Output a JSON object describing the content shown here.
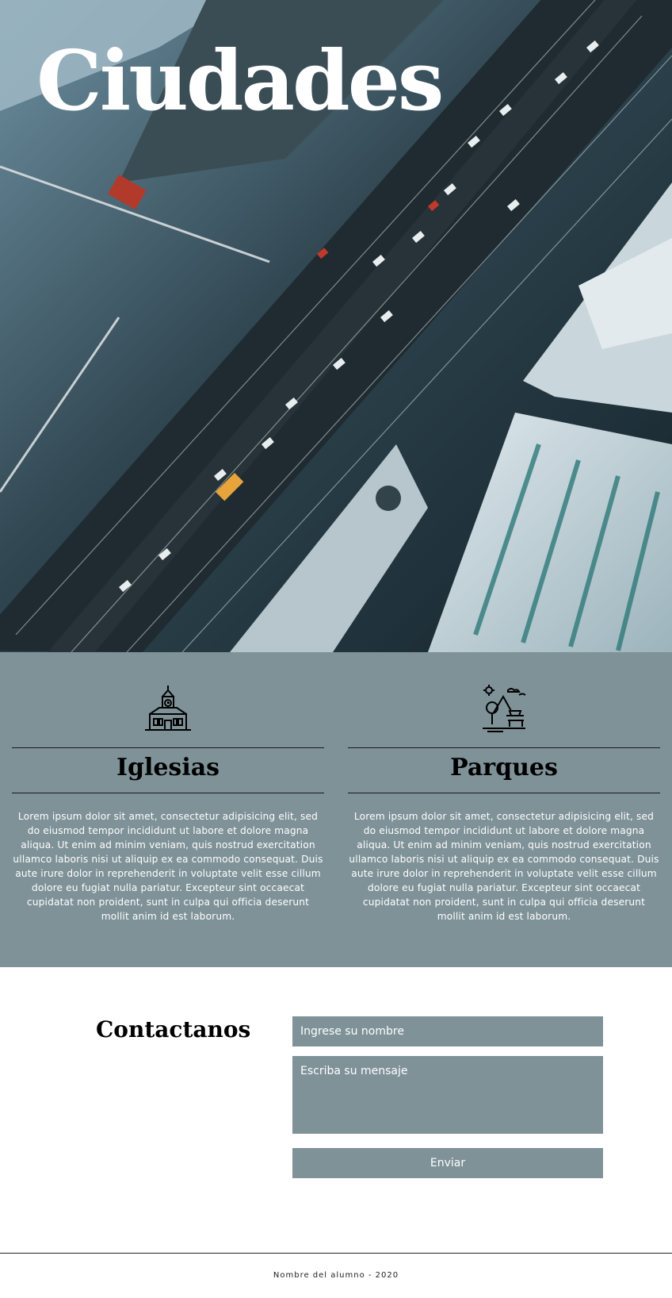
{
  "hero": {
    "title": "Ciudades",
    "image": "aerial-city-highway"
  },
  "features": [
    {
      "icon": "church-icon",
      "title": "Iglesias",
      "text": "Lorem ipsum dolor sit amet, consectetur adipisicing elit, sed do eiusmod tempor incididunt ut labore et dolore magna aliqua. Ut enim ad minim veniam, quis nostrud exercitation ullamco laboris nisi ut aliquip ex ea commodo consequat. Duis aute irure dolor in reprehenderit in voluptate velit esse cillum dolore eu fugiat nulla pariatur. Excepteur sint occaecat cupidatat non proident, sunt in culpa qui officia deserunt mollit anim id est laborum."
    },
    {
      "icon": "park-icon",
      "title": "Parques",
      "text": "Lorem ipsum dolor sit amet, consectetur adipisicing elit, sed do eiusmod tempor incididunt ut labore et dolore magna aliqua. Ut enim ad minim veniam, quis nostrud exercitation ullamco laboris nisi ut aliquip ex ea commodo consequat. Duis aute irure dolor in reprehenderit in voluptate velit esse cillum dolore eu fugiat nulla pariatur. Excepteur sint occaecat cupidatat non proident, sunt in culpa qui officia deserunt mollit anim id est laborum."
    }
  ],
  "contact": {
    "title": "Contactanos",
    "name_placeholder": "Ingrese su nombre",
    "message_placeholder": "Escriba su mensaje",
    "submit_label": "Enviar"
  },
  "footer": {
    "text": "Nombre del alumno - 2020"
  },
  "colors": {
    "panel": "#7f9298",
    "text_light": "#ffffff",
    "heading": "#000000"
  }
}
